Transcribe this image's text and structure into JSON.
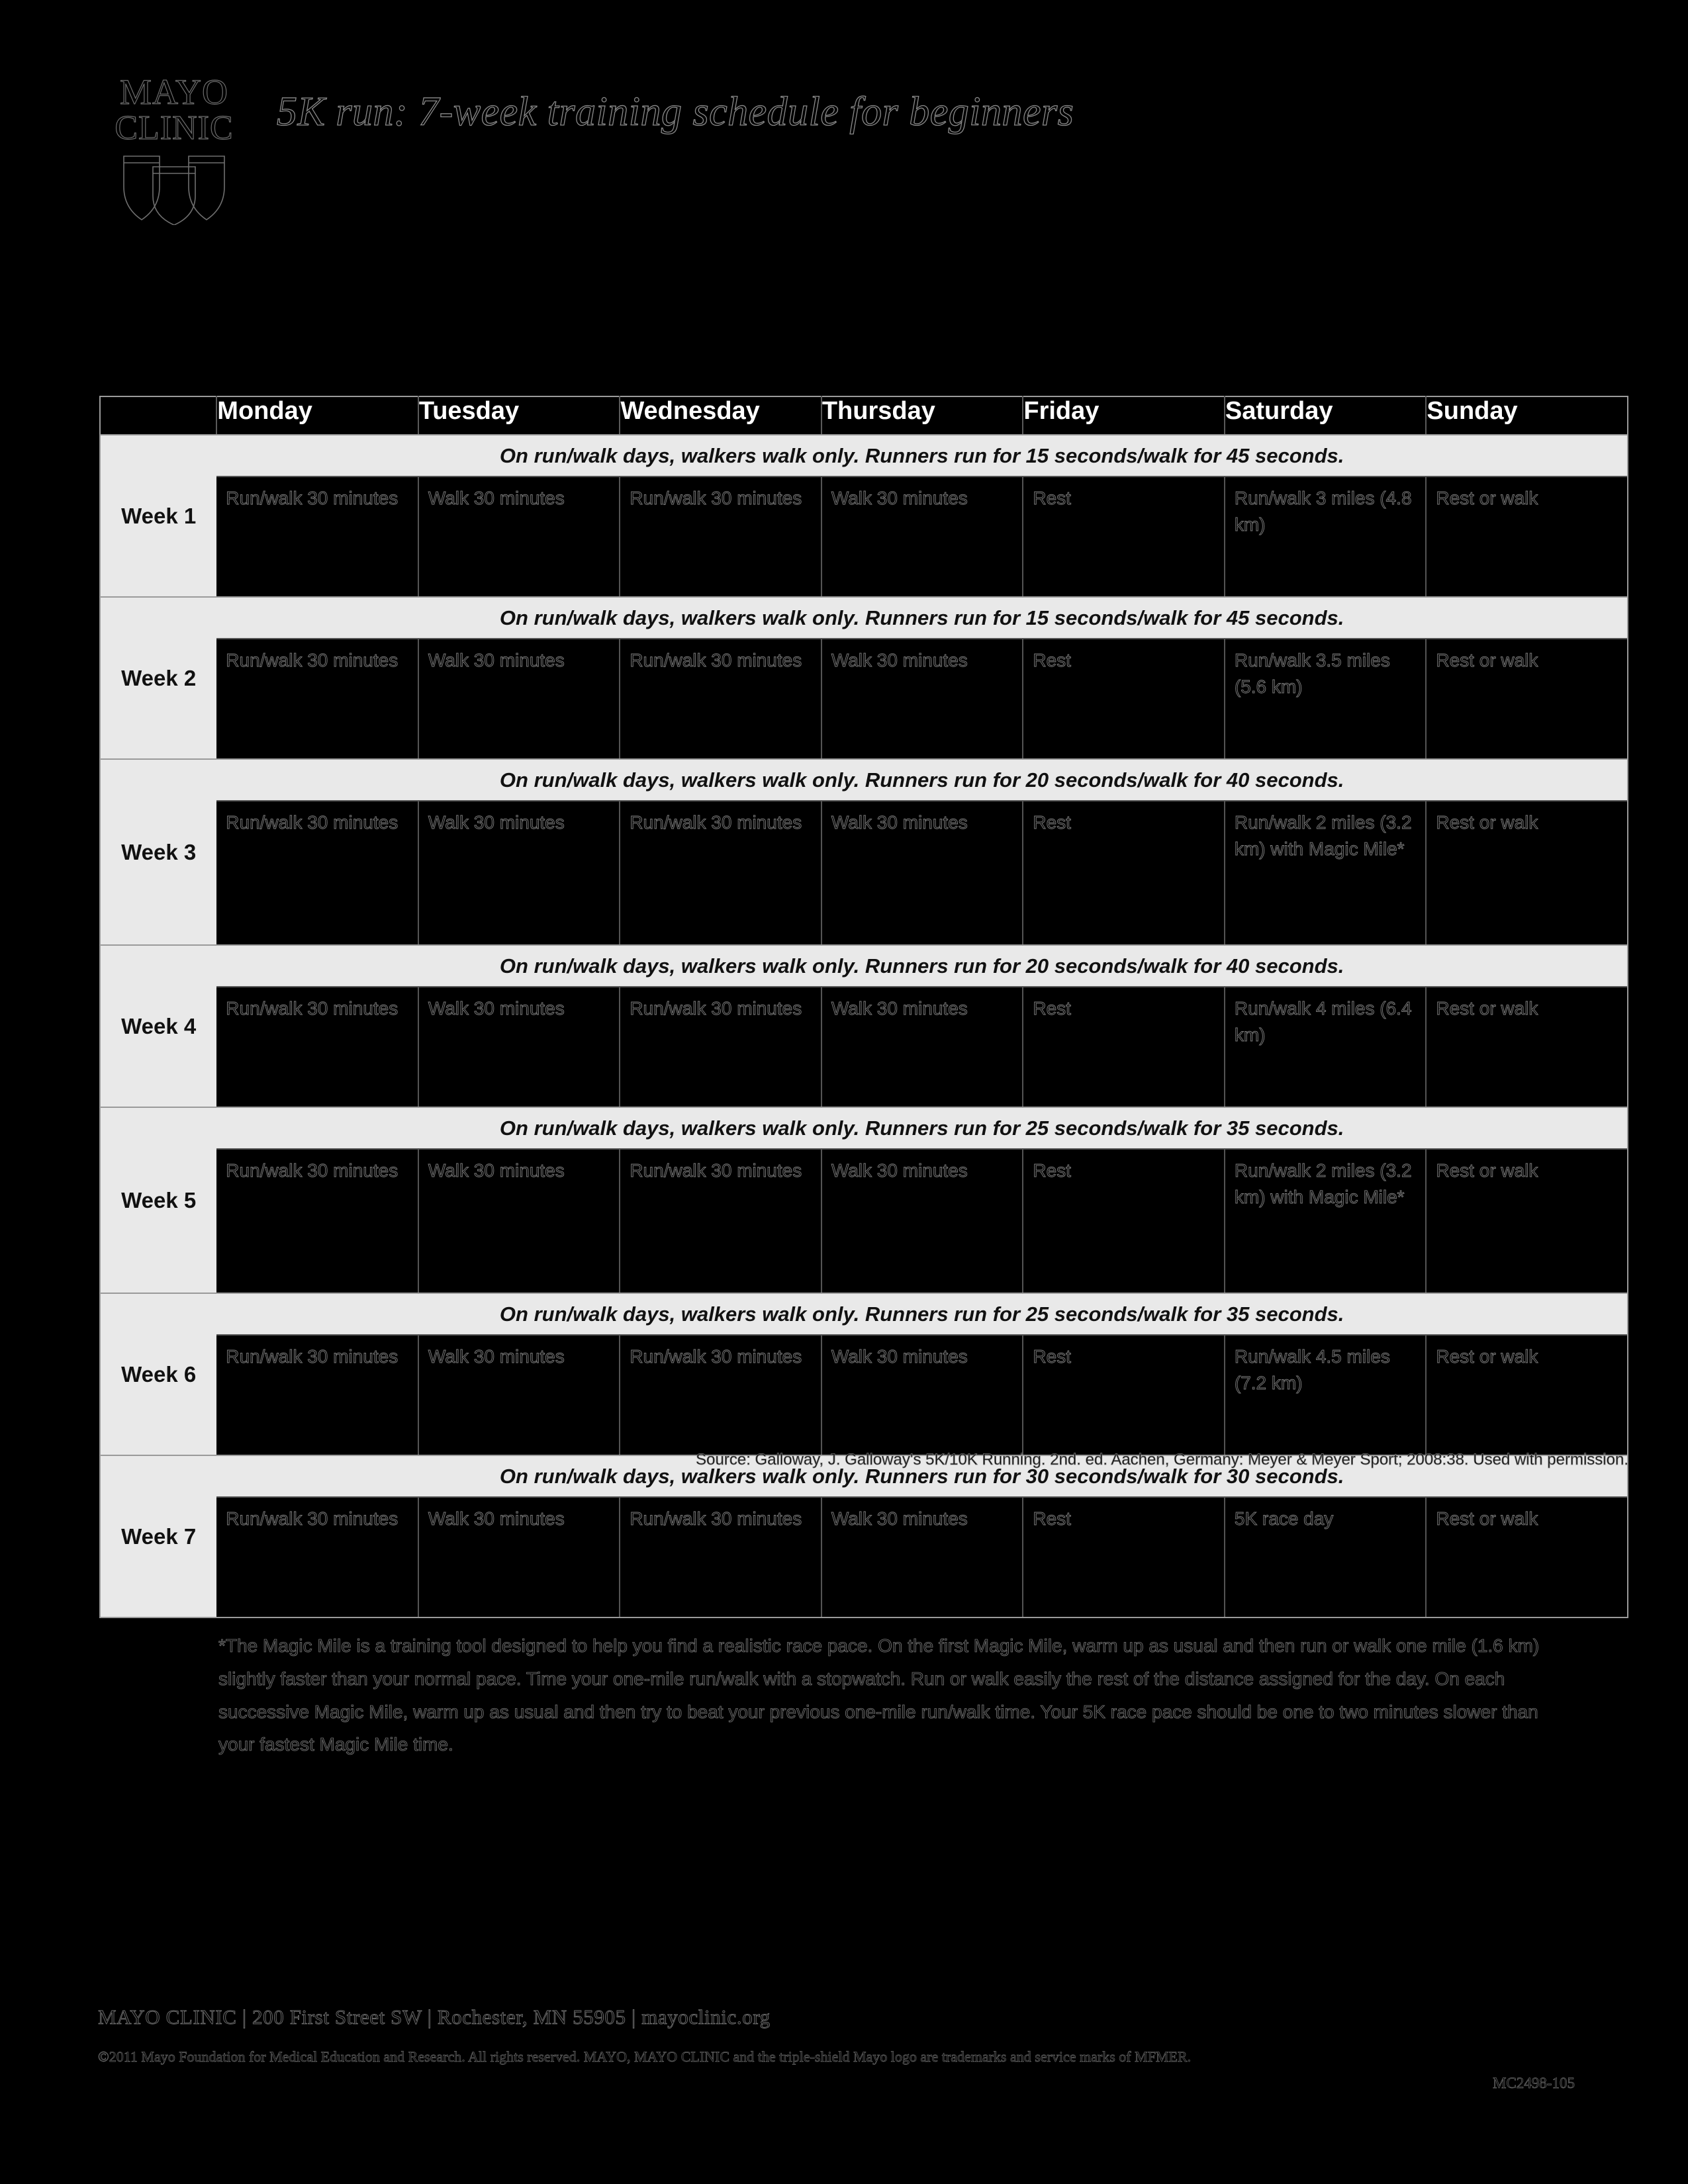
{
  "brand": {
    "logo_line1": "MAYO",
    "logo_line2": "CLINIC",
    "logo_icon": "triple-shield-icon"
  },
  "header": {
    "title": "5K run: 7-week training schedule for beginners"
  },
  "table": {
    "corner_label": "",
    "day_headers": [
      "Monday",
      "Tuesday",
      "Wednesday",
      "Thursday",
      "Friday",
      "Saturday",
      "Sunday"
    ],
    "weeks": [
      {
        "label": "Week 1",
        "note": "On run/walk days, walkers walk only. Runners run for 15 seconds/walk for 45 seconds.",
        "days": [
          "Run/walk 30 minutes",
          "Walk 30 minutes",
          "Run/walk 30 minutes",
          "Walk 30 minutes",
          "Rest",
          "Run/walk 3 miles (4.8 km)",
          "Rest or walk"
        ]
      },
      {
        "label": "Week 2",
        "note": "On run/walk days, walkers walk only. Runners run for 15 seconds/walk for 45 seconds.",
        "days": [
          "Run/walk 30 minutes",
          "Walk 30 minutes",
          "Run/walk 30 minutes",
          "Walk 30 minutes",
          "Rest",
          "Run/walk 3.5 miles (5.6 km)",
          "Rest or walk"
        ]
      },
      {
        "label": "Week 3",
        "note": "On run/walk days, walkers walk only. Runners run for 20 seconds/walk for 40 seconds.",
        "days": [
          "Run/walk 30 minutes",
          "Walk 30 minutes",
          "Run/walk 30 minutes",
          "Walk 30 minutes",
          "Rest",
          "Run/walk 2 miles (3.2 km) with Magic Mile*",
          "Rest or walk"
        ]
      },
      {
        "label": "Week 4",
        "note": "On run/walk days, walkers walk only. Runners run for 20 seconds/walk for 40 seconds.",
        "days": [
          "Run/walk 30 minutes",
          "Walk 30 minutes",
          "Run/walk 30 minutes",
          "Walk 30 minutes",
          "Rest",
          "Run/walk 4 miles (6.4 km)",
          "Rest or walk"
        ]
      },
      {
        "label": "Week 5",
        "note": "On run/walk days, walkers walk only. Runners run for 25 seconds/walk for 35 seconds.",
        "days": [
          "Run/walk 30 minutes",
          "Walk 30 minutes",
          "Run/walk 30 minutes",
          "Walk 30 minutes",
          "Rest",
          "Run/walk 2 miles (3.2 km) with Magic Mile*",
          "Rest or walk"
        ]
      },
      {
        "label": "Week 6",
        "note": "On run/walk days, walkers walk only. Runners run for 25 seconds/walk for 35 seconds.",
        "days": [
          "Run/walk 30 minutes",
          "Walk 30 minutes",
          "Run/walk 30 minutes",
          "Walk 30 minutes",
          "Rest",
          "Run/walk 4.5 miles (7.2 km)",
          "Rest or walk"
        ]
      },
      {
        "label": "Week 7",
        "note": "On run/walk days, walkers walk only. Runners run for 30 seconds/walk for 30 seconds.",
        "days": [
          "Run/walk 30 minutes",
          "Walk 30 minutes",
          "Run/walk 30 minutes",
          "Walk 30 minutes",
          "Rest",
          "5K race day",
          "Rest or walk"
        ]
      }
    ]
  },
  "source": "Source: Galloway, J. Galloway's 5K/10K Running. 2nd. ed. Aachen, Germany: Meyer & Meyer Sport; 2008:38. Used with permission.",
  "footnote": "*The Magic Mile is a training tool designed to help you find a realistic race pace. On the first Magic Mile, warm up as usual and then run or walk one mile (1.6 km) slightly faster than your normal pace. Time your one-mile run/walk with a stopwatch. Run or walk easily the rest of the distance assigned for the day. On each successive Magic Mile, warm up as usual and then try to beat your previous one-mile run/walk time. Your 5K race pace should be one to two minutes slower than your fastest Magic Mile time.",
  "footer": {
    "address": "MAYO CLINIC | 200 First Street SW | Rochester, MN 55905 | mayoclinic.org",
    "copyright": "©2011 Mayo Foundation for Medical Education and Research. All rights reserved. MAYO, MAYO CLINIC and the triple-shield Mayo logo are trademarks and service marks of MFMER.",
    "document_code": "MC2498-105"
  },
  "colors": {
    "page_background": "#000000",
    "header_row_background": "#000000",
    "header_row_text": "#ffffff",
    "week_label_background": "#e9e9e9",
    "note_band_background": "#e9e9e9",
    "cell_background": "#000000",
    "grid_line": "#9a9a9a"
  }
}
